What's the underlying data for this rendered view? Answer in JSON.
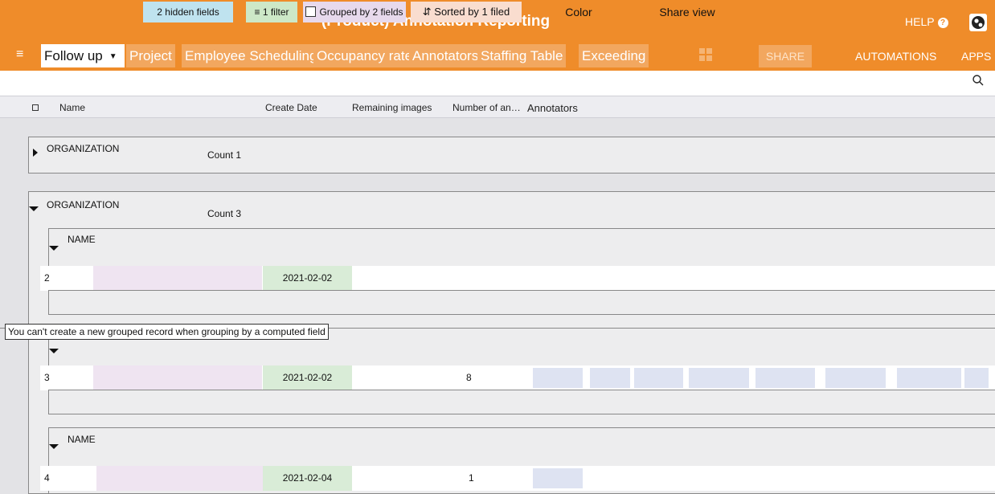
{
  "app": {
    "title": "(Product) Annotation Reporting",
    "help_label": "HELP",
    "help_icon": "?",
    "colors": {
      "accent": "#ef8c2a",
      "tab_light": "#f2a75f"
    }
  },
  "tabs": [
    {
      "label": "Follow up"
    },
    {
      "label": "Project"
    },
    {
      "label": "Employee Scheduling"
    },
    {
      "label": "Occupancy rate"
    },
    {
      "label": "Annotators"
    },
    {
      "label": "Staffing Table"
    },
    {
      "label": "Exceeding"
    }
  ],
  "topbar": {
    "share_label": "SHARE",
    "automations_label": "AUTOMATIONS",
    "apps_label": "APPS"
  },
  "toolbar": {
    "hidden_fields": "2 hidden fields",
    "filter": "1 filter",
    "grouped": "Grouped by 2 fields",
    "sorted": "Sorted by 1 filed",
    "color": "Color",
    "share_view": "Share view"
  },
  "columns": [
    "Name",
    "Create Date",
    "Remaining images",
    "Number of an…",
    "Annotators"
  ],
  "groups": [
    {
      "label": "ORGANIZATION",
      "count": "Count 1"
    },
    {
      "label": "ORGANIZATION",
      "count": "Count 3"
    }
  ],
  "subgroups": [
    {
      "label": "NAME"
    },
    {
      "label": "NAME"
    }
  ],
  "records": [
    {
      "id": "2",
      "date": "2021-02-02",
      "number": ""
    },
    {
      "id": "3",
      "date": "2021-02-02",
      "number": "8"
    },
    {
      "id": "4",
      "date": "2021-02-04",
      "number": "1"
    }
  ],
  "tooltip": "You can't create a new grouped record when grouping by a computed field"
}
